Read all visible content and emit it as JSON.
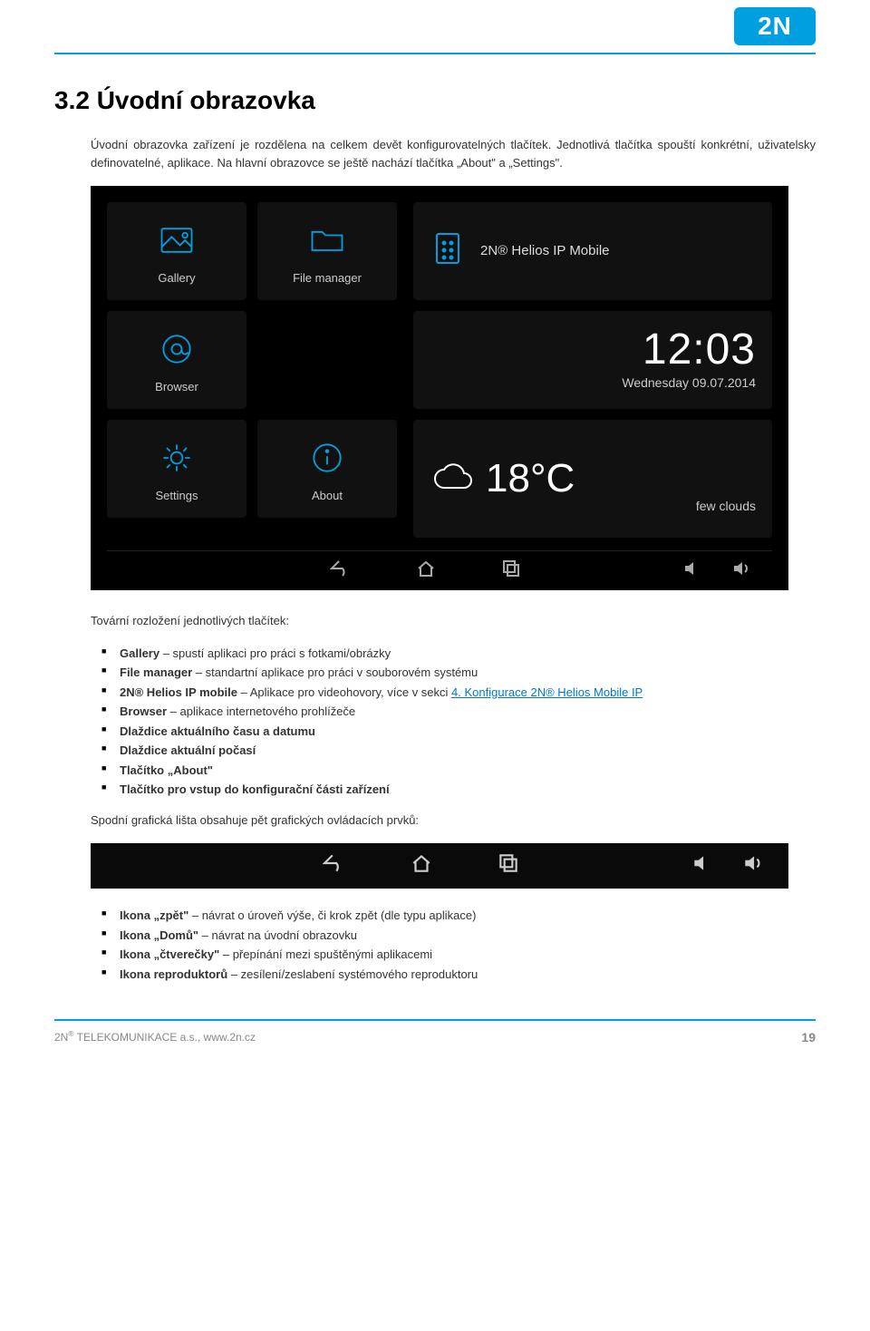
{
  "logo": "2N",
  "title": "3.2 Úvodní obrazovka",
  "intro": "Úvodní obrazovka zařízení je rozdělena na celkem devět konfigurovatelných tlačítek. Jednotlivá tlačítka spouští konkrétní, uživatelsky definovatelné, aplikace. Na hlavní obrazovce se ještě nachází tlačítka „About\" a „Settings\".",
  "screenshot": {
    "tiles": {
      "gallery": "Gallery",
      "filemgr": "File manager",
      "browser": "Browser",
      "settings": "Settings",
      "about": "About",
      "helios": "2N® Helios IP Mobile"
    },
    "clock": {
      "time": "12:03",
      "date": "Wednesday 09.07.2014"
    },
    "weather": {
      "temp": "18°C",
      "desc": "few clouds"
    }
  },
  "layout_heading": "Tovární rozložení jednotlivých tlačítek:",
  "layout_items": [
    {
      "term": "Gallery",
      "desc": " – spustí aplikaci pro práci s fotkami/obrázky"
    },
    {
      "term": "File manager",
      "desc": " – standartní aplikace pro práci v souborovém systému"
    },
    {
      "term": "2N® Helios IP mobile",
      "desc": " – Aplikace pro videohovory, více v sekci ",
      "link_text": "4. Konfigurace 2N® Helios Mobile IP"
    },
    {
      "term": "Browser",
      "desc": " – aplikace internetového prohlížeče"
    },
    {
      "term": "Dlaždice aktuálního času a datumu",
      "desc": ""
    },
    {
      "term": "Dlaždice aktuální počasí",
      "desc": ""
    },
    {
      "term": "Tlačítko „About\"",
      "desc": ""
    },
    {
      "term": "Tlačítko pro vstup do konfigurační části zařízení",
      "desc": ""
    }
  ],
  "navbar_heading": "Spodní grafická lišta obsahuje pět grafických ovládacích prvků:",
  "navbar_items": [
    {
      "term": "Ikona „zpět\"",
      "desc": " – návrat o úroveň výše, či krok zpět (dle typu aplikace)"
    },
    {
      "term": "Ikona „Domů\"",
      "desc": " – návrat na úvodní obrazovku"
    },
    {
      "term": "Ikona „čtverečky\"",
      "desc": " – přepínání mezi spuštěnými aplikacemi"
    },
    {
      "term": "Ikona reproduktorů",
      "desc": " – zesílení/zeslabení systémového reproduktoru"
    }
  ],
  "footer": {
    "left_prefix": "2N",
    "left_rest": " TELEKOMUNIKACE a.s., www.2n.cz",
    "page": "19"
  }
}
